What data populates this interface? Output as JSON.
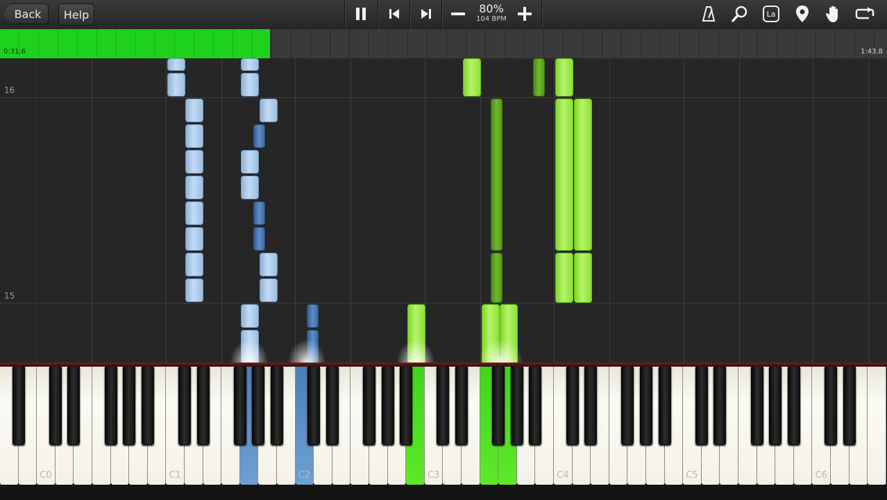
{
  "toolbar": {
    "back_label": "Back",
    "help_label": "Help",
    "speed_percent": "80%",
    "speed_bpm": "104 BPM",
    "icons": {
      "pause": "pause-icon",
      "previous": "skip-back-icon",
      "next": "skip-forward-icon",
      "slower": "minus-icon",
      "faster": "plus-icon",
      "metronome": "metronome-icon",
      "search": "magnifier-icon",
      "note_labels": "note-label-icon",
      "bookmark": "location-pin-icon",
      "hands": "hand-icon",
      "loop": "loop-icon"
    },
    "note_label_text": "La"
  },
  "timeline": {
    "current_time": "0:31.6",
    "total_time": "1:43.8",
    "progress_fraction": 0.304
  },
  "note_area": {
    "measures": [
      "16",
      "15"
    ]
  },
  "keyboard": {
    "octave_labels": [
      "C0",
      "C1",
      "C2",
      "C3",
      "C4",
      "C5",
      "C6"
    ]
  },
  "colors": {
    "left_hand_note": "#a8c8ea",
    "left_hand_dark_note": "#4a7bb5",
    "right_hand_note": "#9be84b",
    "right_hand_dark_note": "#5fa022",
    "progress": "#1dd11d",
    "background": "#262626"
  }
}
